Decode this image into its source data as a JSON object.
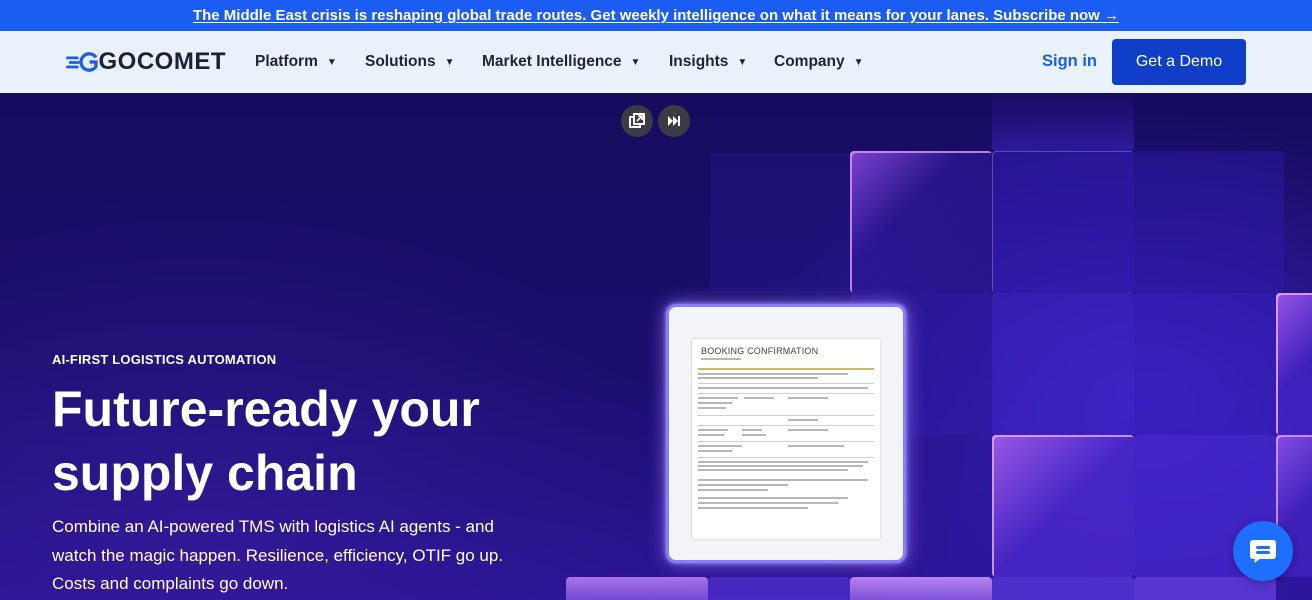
{
  "announcement": {
    "text": "The Middle East crisis is reshaping global trade routes. Get weekly intelligence on what it means for your lanes. Subscribe now →"
  },
  "nav": {
    "logo_text": "GOCOMET",
    "items": [
      {
        "label": "Platform"
      },
      {
        "label": "Solutions"
      },
      {
        "label": "Market Intelligence"
      },
      {
        "label": "Insights"
      },
      {
        "label": "Company"
      }
    ],
    "signin_label": "Sign in",
    "demo_label": "Get a Demo"
  },
  "hero": {
    "eyebrow": "AI-FIRST LOGISTICS AUTOMATION",
    "headline": "Future-ready your supply chain",
    "subtext": "Combine an AI-powered TMS with logistics AI agents - and watch the magic happen. Resilience, efficiency, OTIF go up. Costs and complaints go down."
  },
  "document": {
    "title": "BOOKING CONFIRMATION"
  },
  "icons": {
    "popout": "popout-icon",
    "skip": "skip-forward-icon",
    "chat": "chat-icon",
    "caret": "caret-down-icon"
  },
  "colors": {
    "announcement_bg": "#1b5cf2",
    "nav_bg": "#e9f1fb",
    "brand_blue": "#0f3ec9",
    "link_blue": "#1d5ee6",
    "hero_bg": "#150c5e"
  }
}
